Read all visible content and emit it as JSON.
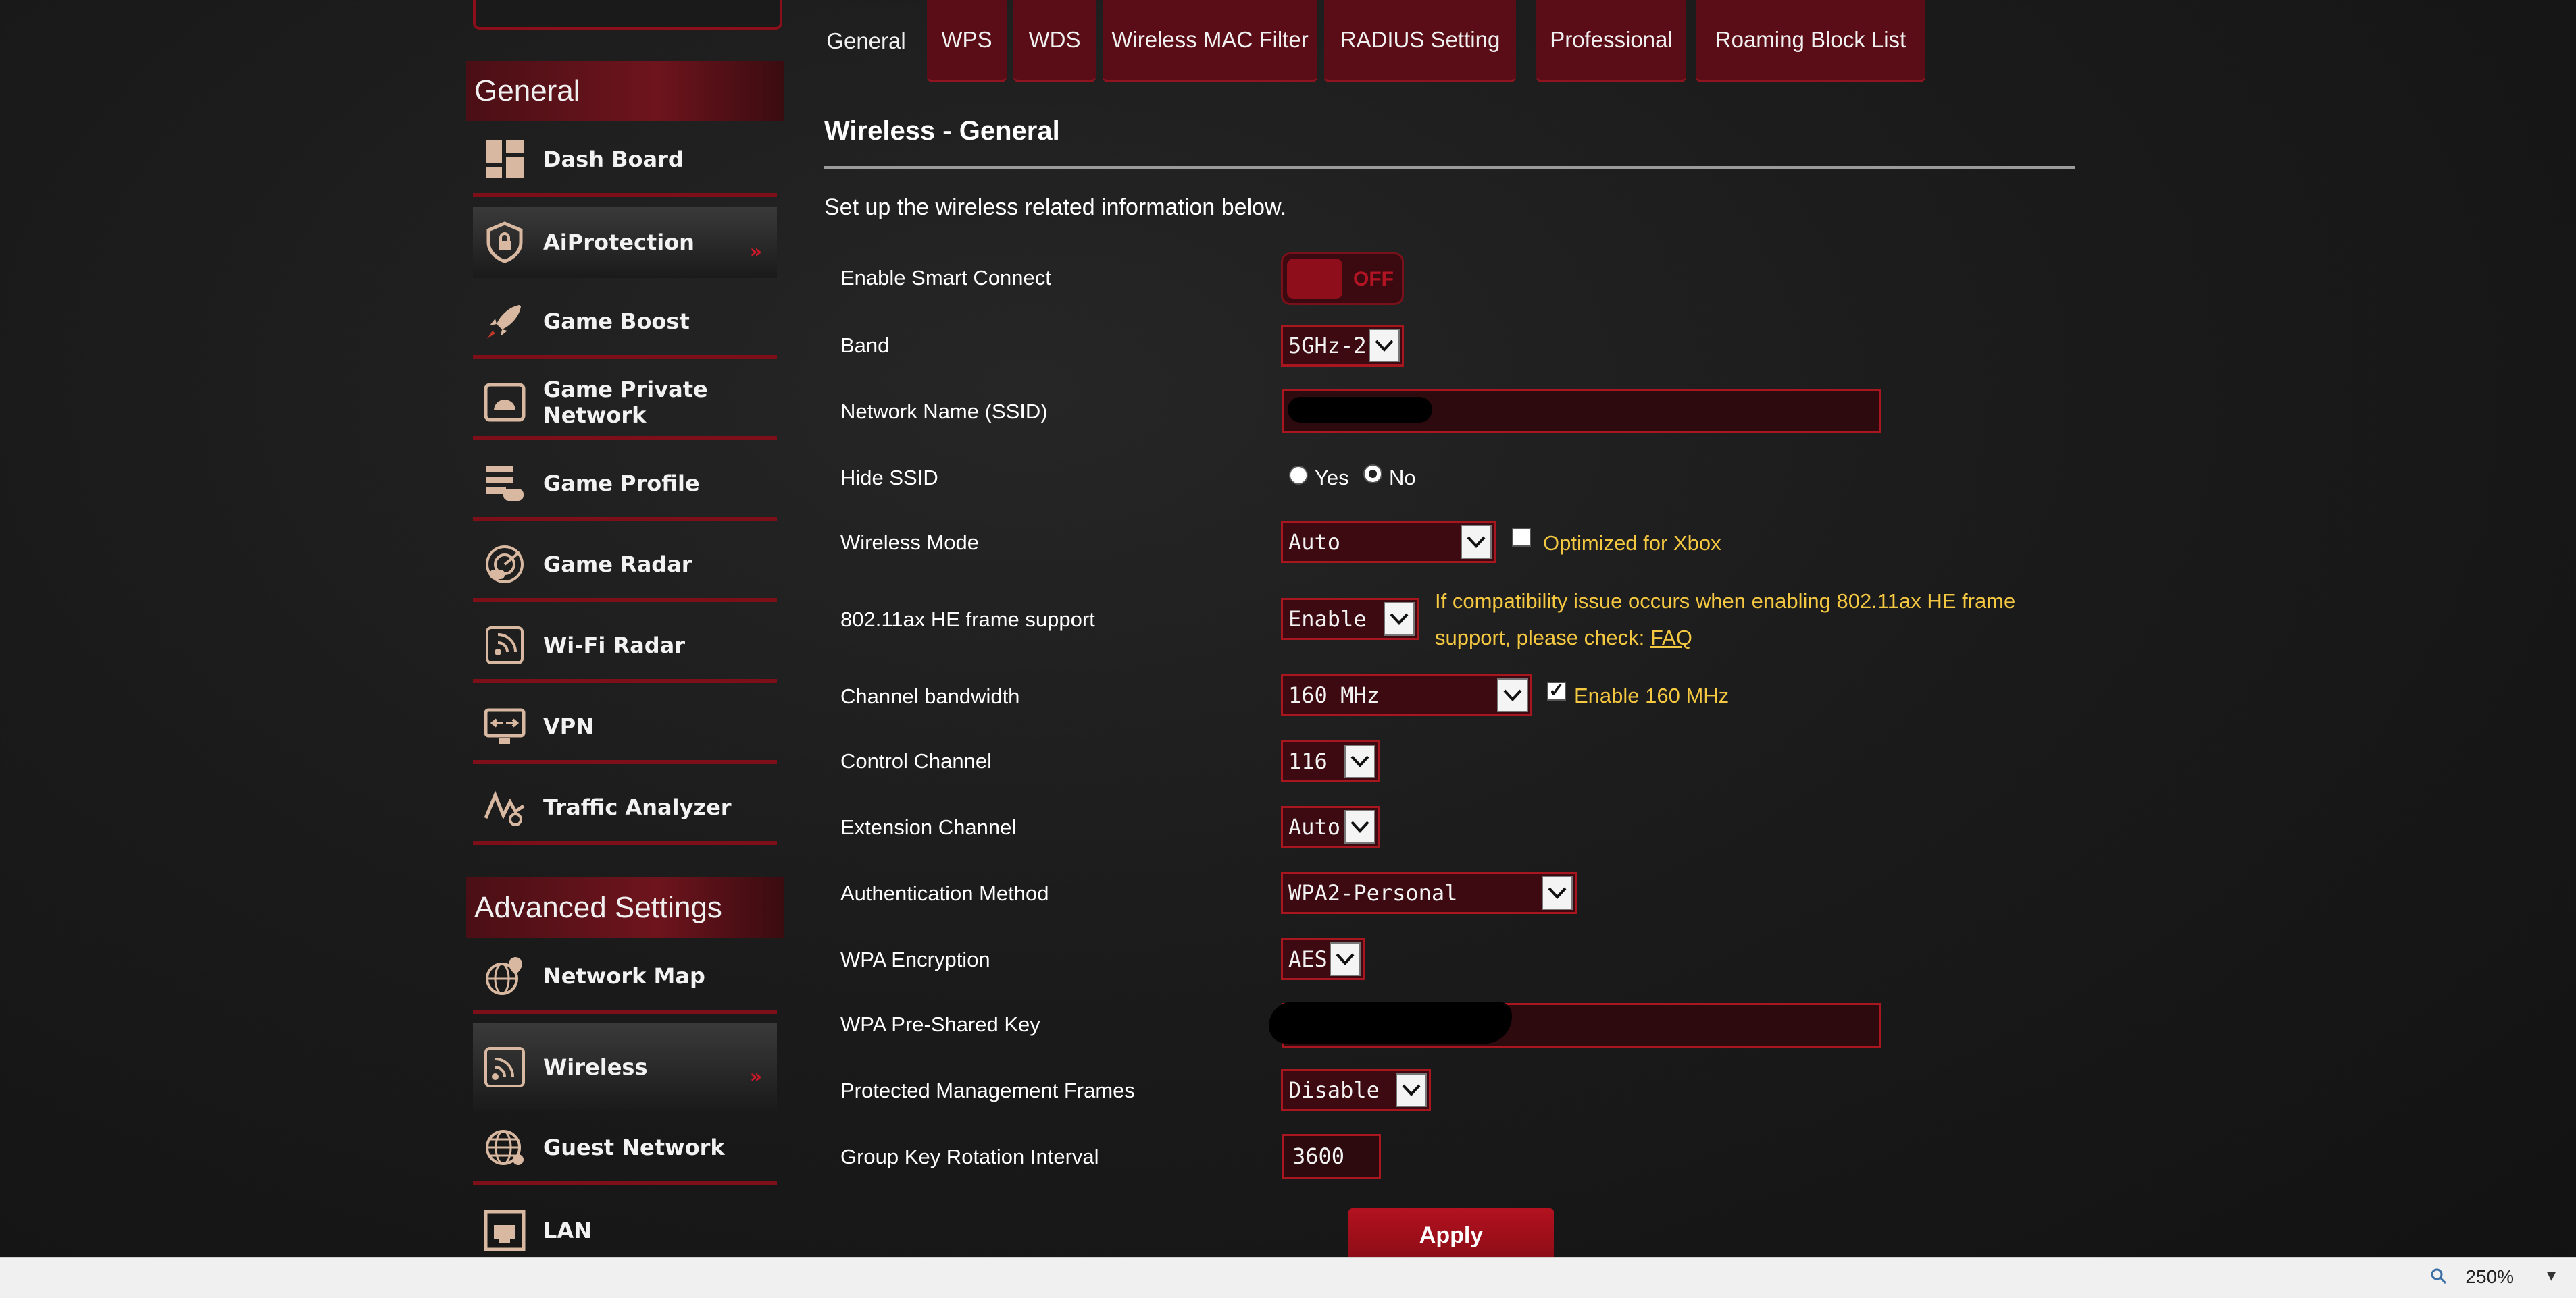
{
  "sidebar": {
    "general_heading": "General",
    "advanced_heading": "Advanced Settings",
    "items": [
      {
        "label": "Dash Board",
        "icon": "dashboard-icon"
      },
      {
        "label": "AiProtection",
        "icon": "shield-lock-icon"
      },
      {
        "label": "Game Boost",
        "icon": "rocket-icon"
      },
      {
        "label": "Game Private Network",
        "icon": "game-network-icon"
      },
      {
        "label": "Game Profile",
        "icon": "game-profile-icon"
      },
      {
        "label": "Game Radar",
        "icon": "radar-icon"
      },
      {
        "label": "Wi-Fi Radar",
        "icon": "wifi-radar-icon"
      },
      {
        "label": "VPN",
        "icon": "vpn-icon"
      },
      {
        "label": "Traffic Analyzer",
        "icon": "traffic-icon"
      },
      {
        "label": "Network Map",
        "icon": "globe-pin-icon"
      },
      {
        "label": "Wireless",
        "icon": "wireless-icon"
      },
      {
        "label": "Guest Network",
        "icon": "globe-icon"
      },
      {
        "label": "LAN",
        "icon": "lan-icon"
      }
    ]
  },
  "tabs": [
    "General",
    "WPS",
    "WDS",
    "Wireless MAC Filter",
    "RADIUS Setting",
    "Professional",
    "Roaming Block List"
  ],
  "page": {
    "title": "Wireless - General",
    "description": "Set up the wireless related information below."
  },
  "form": {
    "smart_connect": {
      "label": "Enable Smart Connect",
      "state": "OFF"
    },
    "band": {
      "label": "Band",
      "value": "5GHz-2"
    },
    "ssid": {
      "label": "Network Name (SSID)",
      "value": ""
    },
    "hide_ssid": {
      "label": "Hide SSID",
      "yes": "Yes",
      "no": "No",
      "selected": "No"
    },
    "wireless_mode": {
      "label": "Wireless Mode",
      "value": "Auto",
      "checkbox_label": "Optimized for Xbox",
      "checked": false
    },
    "he_frame": {
      "label": "802.11ax HE frame support",
      "value": "Enable",
      "note": "If compatibility issue occurs when enabling 802.11ax HE frame support, please check:",
      "note_link": "FAQ"
    },
    "bandwidth": {
      "label": "Channel bandwidth",
      "value": "160 MHz",
      "checkbox_label": "Enable 160 MHz",
      "checked": true
    },
    "control_channel": {
      "label": "Control Channel",
      "value": "116"
    },
    "extension_channel": {
      "label": "Extension Channel",
      "value": "Auto"
    },
    "auth_method": {
      "label": "Authentication Method",
      "value": "WPA2-Personal"
    },
    "wpa_encryption": {
      "label": "WPA Encryption",
      "value": "AES"
    },
    "psk": {
      "label": "WPA Pre-Shared Key",
      "value": ""
    },
    "pmf": {
      "label": "Protected Management Frames",
      "value": "Disable"
    },
    "gkri": {
      "label": "Group Key Rotation Interval",
      "value": "3600"
    }
  },
  "apply_label": "Apply",
  "statusbar": {
    "zoom": "250%"
  },
  "colors": {
    "accent": "#a8161f",
    "note": "#f5c842",
    "background": "#1b1b1b"
  }
}
